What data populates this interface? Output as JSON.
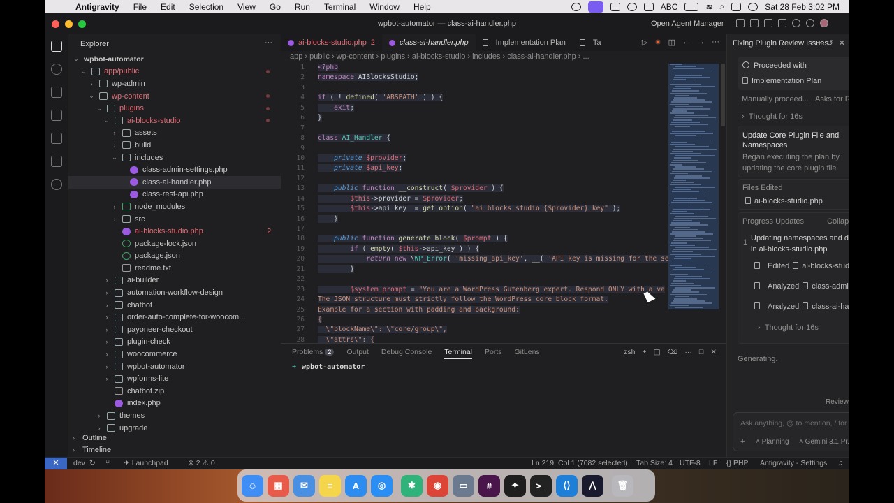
{
  "menubar": {
    "app": "Antigravity",
    "items": [
      "File",
      "Edit",
      "Selection",
      "View",
      "Go",
      "Run",
      "Terminal",
      "Window",
      "Help"
    ],
    "input_source": "ABC",
    "clock": "Sat 28 Feb  3:02 PM"
  },
  "window": {
    "title": "wpbot-automator — class-ai-handler.php",
    "open_agent_manager": "Open Agent Manager"
  },
  "sidebar": {
    "title": "Explorer",
    "tree": [
      {
        "label": "wpbot-automator",
        "depth": 0,
        "chev": "v",
        "icon": "none"
      },
      {
        "label": "app/public",
        "depth": 1,
        "chev": "v",
        "icon": "folder",
        "red": true,
        "dot": true
      },
      {
        "label": "wp-admin",
        "depth": 2,
        "chev": ">",
        "icon": "folder"
      },
      {
        "label": "wp-content",
        "depth": 2,
        "chev": "v",
        "icon": "folder",
        "red": true,
        "dot": true
      },
      {
        "label": "plugins",
        "depth": 3,
        "chev": "v",
        "icon": "folder",
        "red": true,
        "dot": true
      },
      {
        "label": "ai-blocks-studio",
        "depth": 4,
        "chev": "v",
        "icon": "folder",
        "red": true,
        "dot": true
      },
      {
        "label": "assets",
        "depth": 5,
        "chev": ">",
        "icon": "folder"
      },
      {
        "label": "build",
        "depth": 5,
        "chev": ">",
        "icon": "folder"
      },
      {
        "label": "includes",
        "depth": 5,
        "chev": "v",
        "icon": "folder"
      },
      {
        "label": "class-admin-settings.php",
        "depth": 6,
        "chev": "",
        "icon": "php"
      },
      {
        "label": "class-ai-handler.php",
        "depth": 6,
        "chev": "",
        "icon": "php",
        "selected": true
      },
      {
        "label": "class-rest-api.php",
        "depth": 6,
        "chev": "",
        "icon": "php"
      },
      {
        "label": "node_modules",
        "depth": 5,
        "chev": ">",
        "icon": "node"
      },
      {
        "label": "src",
        "depth": 5,
        "chev": ">",
        "icon": "folder"
      },
      {
        "label": "ai-blocks-studio.php",
        "depth": 5,
        "chev": "",
        "icon": "php",
        "red": true,
        "badge": "2"
      },
      {
        "label": "package-lock.json",
        "depth": 5,
        "chev": "",
        "icon": "json"
      },
      {
        "label": "package.json",
        "depth": 5,
        "chev": "",
        "icon": "json"
      },
      {
        "label": "readme.txt",
        "depth": 5,
        "chev": "",
        "icon": "file"
      },
      {
        "label": "ai-builder",
        "depth": 4,
        "chev": ">",
        "icon": "folder"
      },
      {
        "label": "automation-workflow-design",
        "depth": 4,
        "chev": ">",
        "icon": "folder"
      },
      {
        "label": "chatbot",
        "depth": 4,
        "chev": ">",
        "icon": "folder"
      },
      {
        "label": "order-auto-complete-for-woocom...",
        "depth": 4,
        "chev": ">",
        "icon": "folder"
      },
      {
        "label": "payoneer-checkout",
        "depth": 4,
        "chev": ">",
        "icon": "folder"
      },
      {
        "label": "plugin-check",
        "depth": 4,
        "chev": ">",
        "icon": "folder"
      },
      {
        "label": "woocommerce",
        "depth": 4,
        "chev": ">",
        "icon": "folder"
      },
      {
        "label": "wpbot-automator",
        "depth": 4,
        "chev": ">",
        "icon": "folder"
      },
      {
        "label": "wpforms-lite",
        "depth": 4,
        "chev": ">",
        "icon": "folder"
      },
      {
        "label": "chatbot.zip",
        "depth": 4,
        "chev": "",
        "icon": "file"
      },
      {
        "label": "index.php",
        "depth": 4,
        "chev": "",
        "icon": "php"
      },
      {
        "label": "themes",
        "depth": 3,
        "chev": ">",
        "icon": "folder"
      },
      {
        "label": "upgrade",
        "depth": 3,
        "chev": ">",
        "icon": "folder"
      }
    ],
    "outline": "Outline",
    "timeline": "Timeline"
  },
  "editor": {
    "tabs": [
      {
        "label": "ai-blocks-studio.php",
        "badge": "2",
        "active": false,
        "err": true
      },
      {
        "label": "class-ai-handler.php",
        "active": true
      },
      {
        "label": "Implementation Plan",
        "active": false
      },
      {
        "label": "Ta",
        "active": false
      }
    ],
    "breadcrumb": [
      "app",
      "public",
      "wp-content",
      "plugins",
      "ai-blocks-studio",
      "includes",
      "class-ai-handler.php",
      "..."
    ],
    "lines": [
      {
        "n": "1",
        "html": "<span class='kw'>&lt;?php</span>"
      },
      {
        "n": "2",
        "html": "<span class='kw'>namespace</span> AIBlocksStudio;"
      },
      {
        "n": "3",
        "html": ""
      },
      {
        "n": "4",
        "html": "<span class='kw'>if</span> ( ! <span class='fn'>defined</span>( <span class='st'>'ABSPATH'</span> ) ) {"
      },
      {
        "n": "5",
        "html": "    <span class='kw'>exit</span>;"
      },
      {
        "n": "6",
        "html": "}"
      },
      {
        "n": "7",
        "html": ""
      },
      {
        "n": "8",
        "html": "<span class='kw'>class</span> <span class='ty'>AI_Handler</span> {"
      },
      {
        "n": "9",
        "html": ""
      },
      {
        "n": "10",
        "html": "    <span class='kwb'><i>private</i></span> <span class='vr'>$provider</span>;"
      },
      {
        "n": "11",
        "html": "    <span class='kwb'><i>private</i></span> <span class='vr'>$api_key</span>;"
      },
      {
        "n": "12",
        "html": ""
      },
      {
        "n": "13",
        "html": "    <span class='kwb'><i>public</i></span> <span class='kw'>function</span> <span class='fn'>__construct</span>( <span class='vr'>$provider</span> ) {"
      },
      {
        "n": "14",
        "html": "        <span class='vr'>$this</span>-&gt;provider = <span class='vr'>$provider</span>;"
      },
      {
        "n": "15",
        "html": "        <span class='vr'>$this</span>-&gt;api_key  = <span class='fn'>get_option</span>( <span class='st'>\"ai_blocks_studio_{$provider}_key\"</span> );"
      },
      {
        "n": "16",
        "html": "    }"
      },
      {
        "n": "17",
        "html": ""
      },
      {
        "n": "18",
        "html": "    <span class='kwb'><i>public</i></span> <span class='kw'>function</span> <span class='fn'>generate_block</span>( <span class='vr'>$prompt</span> ) {"
      },
      {
        "n": "19",
        "html": "        <span class='kw'>if</span> ( <span class='fn'>empty</span>( <span class='vr'>$this</span>-&gt;api_key ) ) {"
      },
      {
        "n": "20",
        "html": "            <span class='kw'><i>return</i></span> <span class='kw'>new</span> \\<span class='ty'>WP_Error</span>( <span class='st'>'missing_api_key'</span>, <span class='fn'>__</span>( <span class='st'>'API key is missing for the se</span>"
      },
      {
        "n": "21",
        "html": "        }"
      },
      {
        "n": "22",
        "html": ""
      },
      {
        "n": "23",
        "html": "        <span class='vr'>$system_prompt</span> = <span class='st'>\"You are a WordPress Gutenberg expert. Respond ONLY with a va</span>"
      },
      {
        "n": "24",
        "html": "<span class='st'>The JSON structure must strictly follow the WordPress core block format.</span>"
      },
      {
        "n": "25",
        "html": "<span class='st'>Example for a section with padding and background:</span>"
      },
      {
        "n": "26",
        "html": "<span class='st'>{</span>"
      },
      {
        "n": "27",
        "html": "<span class='st'>  \\\"blockName\\\": \\\"core/group\\\",</span>"
      },
      {
        "n": "28",
        "html": "<span class='st'>  \\\"attrs\\\": {</span>"
      }
    ]
  },
  "panel": {
    "tabs": [
      {
        "label": "Problems",
        "count": "2",
        "active": false
      },
      {
        "label": "Output",
        "active": false
      },
      {
        "label": "Debug Console",
        "active": false
      },
      {
        "label": "Terminal",
        "active": true
      },
      {
        "label": "Ports",
        "active": false
      },
      {
        "label": "GitLens",
        "active": false
      }
    ],
    "shell": "zsh",
    "prompt_dir": "wpbot-automator"
  },
  "agent": {
    "title": "Fixing Plugin Review Issues",
    "proceeded_with": "Proceeded with",
    "plan_link": "Implementation Plan",
    "manual": "Manually proceed...",
    "asks": "Asks for Review",
    "thought1": "Thought for 16s",
    "task_title": "Update Core Plugin File and Namespaces",
    "task_desc": "Began executing the plan by updating the core plugin file.",
    "files_edited_label": "Files Edited",
    "file_edited": "ai-blocks-studio.php",
    "progress_label": "Progress Updates",
    "collapse_all": "Collapse all",
    "progress_num": "1",
    "progress_text": "Updating namespaces and defines in ai-blocks-studio.php",
    "steps": [
      {
        "verb": "Edited",
        "target": "ai-blocks-studi"
      },
      {
        "verb": "Analyzed",
        "target": "class-admin-se"
      },
      {
        "verb": "Analyzed",
        "target": "class-ai-handle"
      }
    ],
    "thought2": "Thought for 16s",
    "generating": "Generating.",
    "review_changes": "Review Changes",
    "input_placeholder": "Ask anything, @ to mention, / for workflo...",
    "mode": "Planning",
    "model": "Gemini 3.1 Pr..."
  },
  "statusbar": {
    "branch": "dev",
    "launchpad": "Launchpad",
    "errors": "2",
    "warnings": "0",
    "position": "Ln 219, Col 1 (7082 selected)",
    "tab_size": "Tab Size: 4",
    "encoding": "UTF-8",
    "eol": "LF",
    "language": "PHP",
    "settings": "Antigravity - Settings"
  },
  "dock": [
    {
      "name": "finder",
      "color": "#3f8ef5",
      "glyph": "☺"
    },
    {
      "name": "launchpad",
      "color": "#e85b4a",
      "glyph": "▦"
    },
    {
      "name": "mail",
      "color": "#4a90e2",
      "glyph": "✉"
    },
    {
      "name": "notes",
      "color": "#f5d54a",
      "glyph": "≡"
    },
    {
      "name": "app-store",
      "color": "#2d8cf0",
      "glyph": "A"
    },
    {
      "name": "safari",
      "color": "#2a8ef5",
      "glyph": "◎"
    },
    {
      "name": "chatgpt",
      "color": "#2fb37a",
      "glyph": "✱"
    },
    {
      "name": "chrome",
      "color": "#db4437",
      "glyph": "◉"
    },
    {
      "name": "preview",
      "color": "#6b7a8f",
      "glyph": "▭"
    },
    {
      "name": "slack",
      "color": "#4a154b",
      "glyph": "#"
    },
    {
      "name": "figma",
      "color": "#1e1e1e",
      "glyph": "✦"
    },
    {
      "name": "terminal",
      "color": "#222",
      "glyph": ">_"
    },
    {
      "name": "vscode",
      "color": "#1e7fd8",
      "glyph": "⟨⟩"
    },
    {
      "name": "antigravity",
      "color": "#1a1a2e",
      "glyph": "⋀"
    },
    {
      "name": "trash",
      "color": "#b7b7bc",
      "glyph": "🗑"
    }
  ]
}
